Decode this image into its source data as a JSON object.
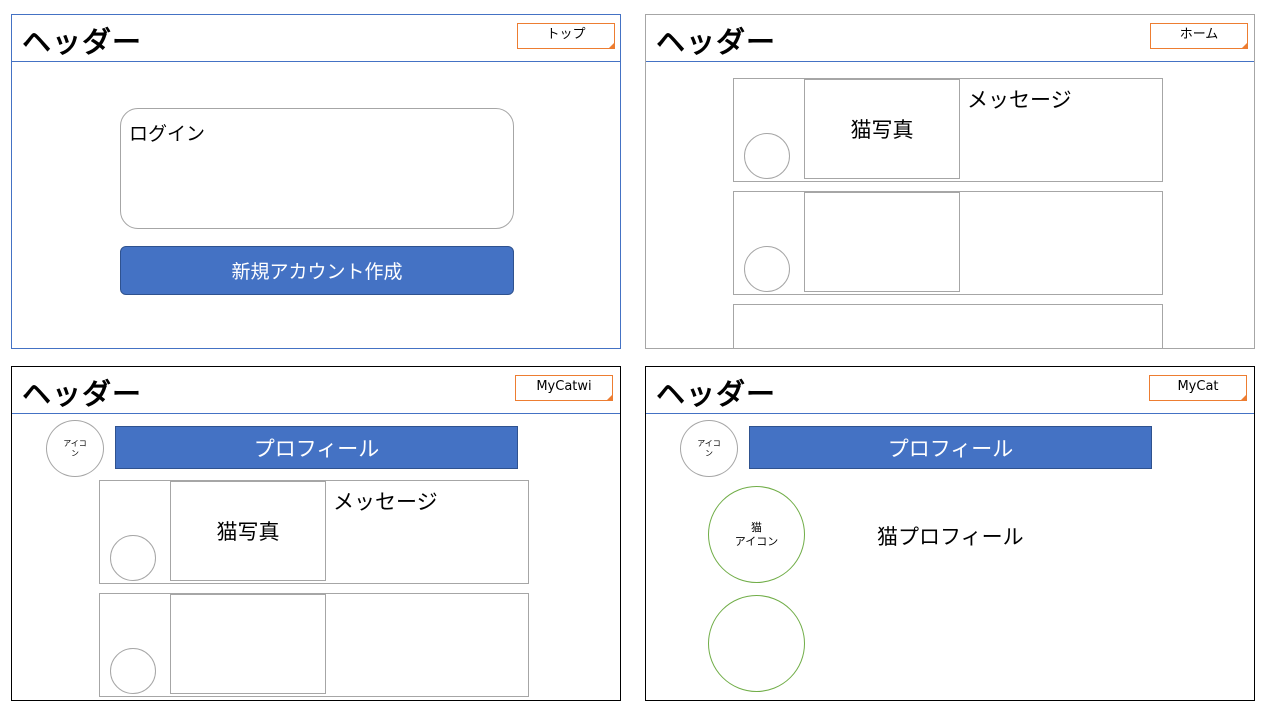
{
  "colors": {
    "accent": "#4472c4",
    "tab_border": "#ed7d31",
    "circle_green": "#70ad47"
  },
  "panels": {
    "top": {
      "header": "ヘッダー",
      "tab": "トップ",
      "login_label": "ログイン",
      "signup_button": "新規アカウント作成"
    },
    "home": {
      "header": "ヘッダー",
      "tab": "ホーム",
      "message_label": "メッセージ",
      "photo_label": "猫写真"
    },
    "mycatwi": {
      "header": "ヘッダー",
      "tab": "MyCatwi",
      "icon_label": "アイコ\nン",
      "profile_label": "プロフィール",
      "message_label": "メッセージ",
      "photo_label": "猫写真"
    },
    "mycat": {
      "header": "ヘッダー",
      "tab": "MyCat",
      "icon_label": "アイコ\nン",
      "profile_label": "プロフィール",
      "cat_icon_label": "猫\nアイコン",
      "cat_profile_label": "猫プロフィール"
    }
  }
}
